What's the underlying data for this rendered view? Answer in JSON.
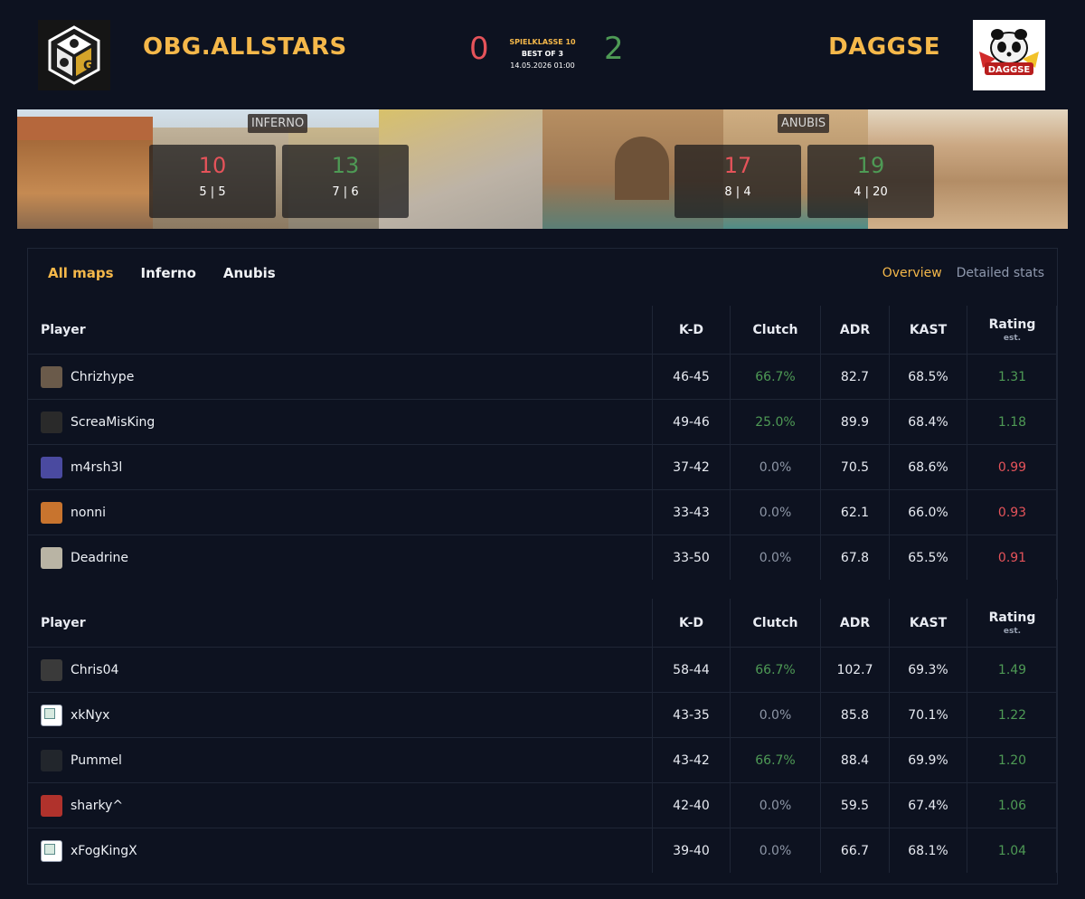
{
  "match": {
    "team_left": {
      "name": "OBG.ALLSTARS",
      "score": "0"
    },
    "team_right": {
      "name": "DAGGSE",
      "score": "2"
    },
    "league": "SPIELKLASSE 10",
    "format": "BEST OF 3",
    "date": "14.05.2026 01:00",
    "right_logo_text": "DAGGSE"
  },
  "maps": [
    {
      "name": "INFERNO",
      "left_score": "10",
      "left_sub": "5 | 5",
      "right_score": "13",
      "right_sub": "7 | 6"
    },
    {
      "name": "ANUBIS",
      "left_score": "17",
      "left_sub": "8 | 4",
      "right_score": "19",
      "right_sub": "4 | 20"
    }
  ],
  "tabs": {
    "maps": [
      "All maps",
      "Inferno",
      "Anubis"
    ],
    "views": [
      "Overview",
      "Detailed stats"
    ]
  },
  "columns": {
    "player": "Player",
    "kd": "K-D",
    "clutch": "Clutch",
    "adr": "ADR",
    "kast": "KAST",
    "rating": "Rating",
    "rating_sub": "est."
  },
  "teams": [
    {
      "players": [
        {
          "name": "Chrizhype",
          "kd": "46-45",
          "clutch": "66.7%",
          "adr": "82.7",
          "kast": "68.5%",
          "rating": "1.31",
          "avatar_color": "#6a5a4a"
        },
        {
          "name": "ScreaMisKing",
          "kd": "49-46",
          "clutch": "25.0%",
          "adr": "89.9",
          "kast": "68.4%",
          "rating": "1.18",
          "avatar_color": "#2a2a2a"
        },
        {
          "name": "m4rsh3l",
          "kd": "37-42",
          "clutch": "0.0%",
          "adr": "70.5",
          "kast": "68.6%",
          "rating": "0.99",
          "avatar_color": "#4a4aa0"
        },
        {
          "name": "nonni",
          "kd": "33-43",
          "clutch": "0.0%",
          "adr": "62.1",
          "kast": "66.0%",
          "rating": "0.93",
          "avatar_color": "#c8742e"
        },
        {
          "name": "Deadrine",
          "kd": "33-50",
          "clutch": "0.0%",
          "adr": "67.8",
          "kast": "65.5%",
          "rating": "0.91",
          "avatar_color": "#b9b4a4"
        }
      ]
    },
    {
      "players": [
        {
          "name": "Chris04",
          "kd": "58-44",
          "clutch": "66.7%",
          "adr": "102.7",
          "kast": "69.3%",
          "rating": "1.49",
          "avatar_color": "#3a3a3a"
        },
        {
          "name": "xkNyx",
          "kd": "43-35",
          "clutch": "0.0%",
          "adr": "85.8",
          "kast": "70.1%",
          "rating": "1.22",
          "avatar_color": "broken"
        },
        {
          "name": "Pummel",
          "kd": "43-42",
          "clutch": "66.7%",
          "adr": "88.4",
          "kast": "69.9%",
          "rating": "1.20",
          "avatar_color": "#22262c"
        },
        {
          "name": "sharky^",
          "kd": "42-40",
          "clutch": "0.0%",
          "adr": "59.5",
          "kast": "67.4%",
          "rating": "1.06",
          "avatar_color": "#b0322c"
        },
        {
          "name": "xFogKingX",
          "kd": "39-40",
          "clutch": "0.0%",
          "adr": "66.7",
          "kast": "68.1%",
          "rating": "1.04",
          "avatar_color": "broken"
        }
      ]
    }
  ],
  "colors": {
    "accent": "#f5b84a",
    "loss": "#e5535a",
    "win": "#4e9a55",
    "background": "#0d1220"
  }
}
